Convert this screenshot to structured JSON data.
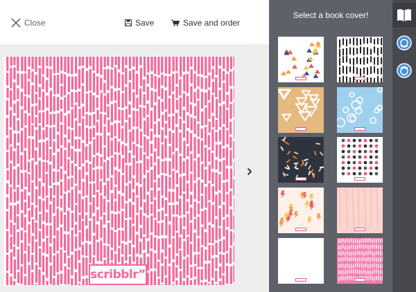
{
  "toolbar": {
    "close_label": "Close",
    "save_label": "Save",
    "order_label": "Save and order"
  },
  "cover": {
    "logo_text": "scribblr",
    "logo_mark": "”"
  },
  "panel": {
    "title": "Select a book cover!",
    "thumbnails": [
      {
        "name": "triangles-confetti",
        "bg": "#ffffff"
      },
      {
        "name": "black-strokes",
        "bg": "#ffffff"
      },
      {
        "name": "tan-triangles",
        "bg": "#e5b97f"
      },
      {
        "name": "blue-circles",
        "bg": "#9fd0ef"
      },
      {
        "name": "navy-sprinkles",
        "bg": "#2e3340"
      },
      {
        "name": "polka-dots",
        "bg": "#ffffff"
      },
      {
        "name": "lightning-bolts",
        "bg": "#fdf1ea"
      },
      {
        "name": "peach-wood",
        "bg": "#fbd4cf"
      },
      {
        "name": "plain-white",
        "bg": "#ffffff"
      },
      {
        "name": "pink-strokes",
        "bg": "#f27fb0"
      }
    ]
  },
  "tabs": [
    {
      "icon": "book-icon"
    },
    {
      "icon": "sticker-icon"
    },
    {
      "icon": "face-icon"
    }
  ],
  "colors": {
    "accent_pink": "#f36a9c",
    "panel_bg": "#5e6268",
    "tab_bg": "#47494e"
  }
}
